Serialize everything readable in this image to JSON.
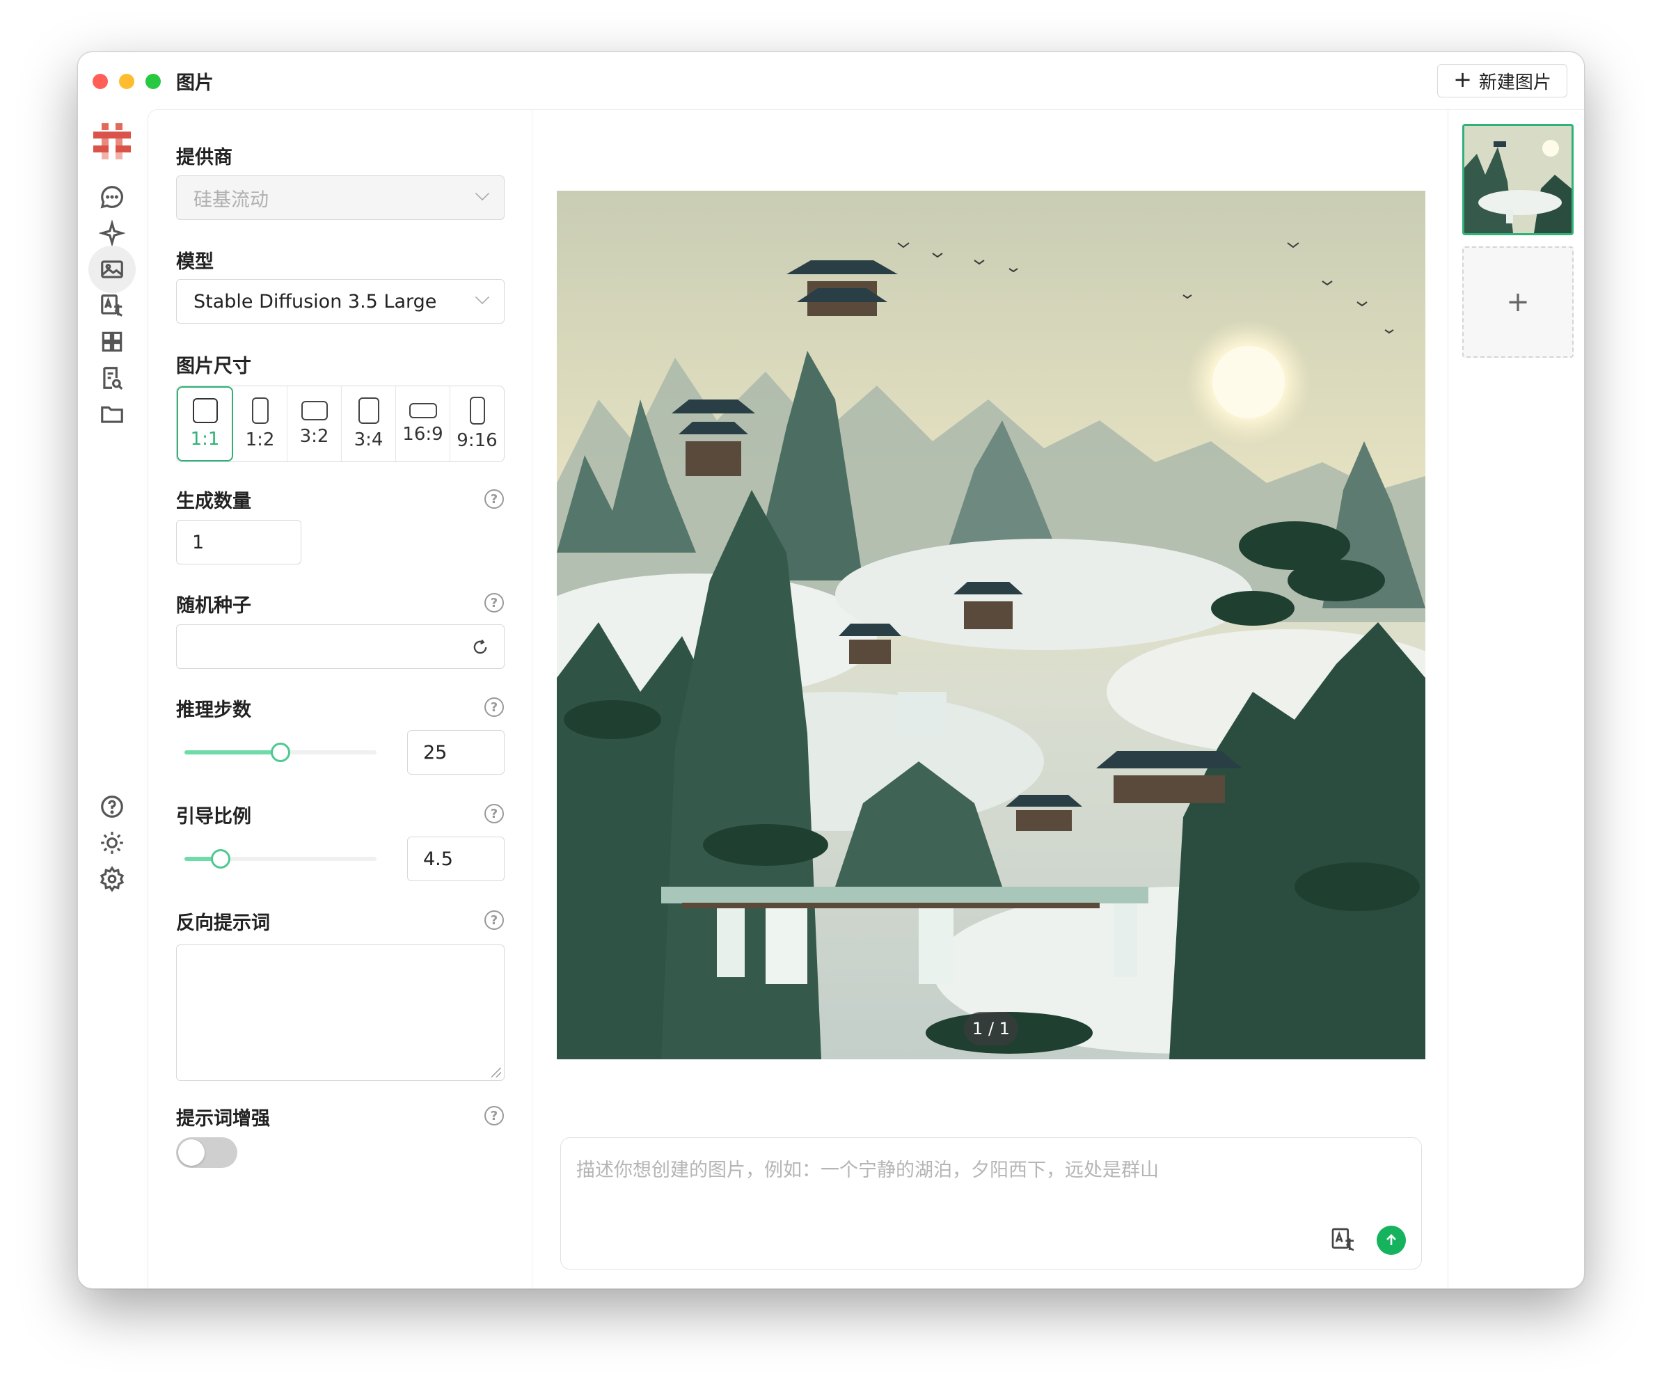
{
  "window": {
    "title": "图片",
    "new_image_label": "新建图片"
  },
  "settings": {
    "provider": {
      "label": "提供商",
      "value": "硅基流动"
    },
    "model": {
      "label": "模型",
      "value": "Stable Diffusion 3.5 Large"
    },
    "size": {
      "label": "图片尺寸",
      "options": [
        "1:1",
        "1:2",
        "3:2",
        "3:4",
        "16:9",
        "9:16"
      ],
      "selected": "1:1"
    },
    "count": {
      "label": "生成数量",
      "value": "1"
    },
    "seed": {
      "label": "随机种子",
      "value": ""
    },
    "steps": {
      "label": "推理步数",
      "value": "25",
      "slider_fraction": 0.5
    },
    "guidance": {
      "label": "引导比例",
      "value": "4.5",
      "slider_fraction": 0.19
    },
    "negative_prompt": {
      "label": "反向提示词",
      "value": ""
    },
    "prompt_enhance": {
      "label": "提示词增强",
      "enabled": false
    }
  },
  "preview": {
    "counter": "1 / 1",
    "prompt_placeholder": "描述你想创建的图片，例如：一个宁静的湖泊，夕阳西下，远处是群山"
  },
  "colors": {
    "accent": "#2fb277",
    "send": "#16b35e"
  },
  "icons": [
    "chat-icon",
    "sparkle-icon",
    "image-icon",
    "translate-icon",
    "grid-icon",
    "document-search-icon",
    "folder-icon",
    "help-icon",
    "sun-icon",
    "gear-icon"
  ]
}
